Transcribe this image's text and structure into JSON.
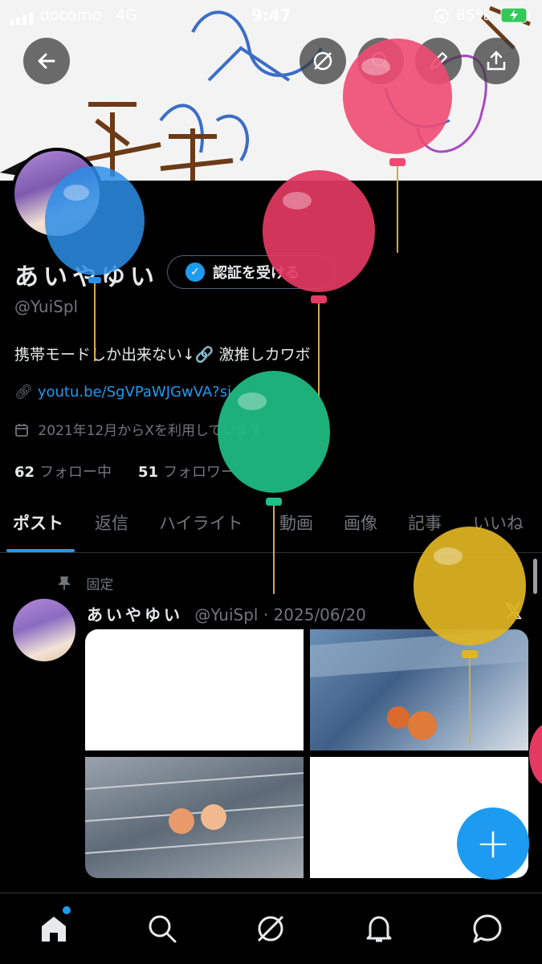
{
  "status_bar": {
    "carrier": "docomo",
    "network": "4G",
    "time": "9:47",
    "battery": "85%"
  },
  "profile": {
    "display_name": "あいやゆい",
    "verify_label": "認証を受ける",
    "handle": "@YuiSpl",
    "bio": "携帯モードしか出来ない↓🔗 激推しカワボ",
    "link": "youtu.be/SgVPaWJGwVA?si...",
    "joined": "2021年12月からXを利用しています",
    "following_count": "62",
    "following_label": "フォロー中",
    "followers_count": "51",
    "followers_label": "フォロワー"
  },
  "tabs": [
    "ポスト",
    "返信",
    "ハイライト",
    "動画",
    "画像",
    "記事",
    "いいね"
  ],
  "post": {
    "pinned_label": "固定",
    "author_name": "あいやゆい",
    "author_handle": "@YuiSpl",
    "date": "· 2025/06/20",
    "x_logo": "𝕏"
  },
  "fab_label": "+",
  "colors": {
    "accent": "#1d9bf0",
    "background": "#000000",
    "muted_text": "#71767b"
  },
  "icons": [
    "back-arrow-icon",
    "grok-icon",
    "search-icon",
    "edit-icon",
    "share-icon",
    "link-icon",
    "calendar-icon",
    "pin-icon",
    "home-icon",
    "notifications-icon",
    "messages-icon"
  ]
}
